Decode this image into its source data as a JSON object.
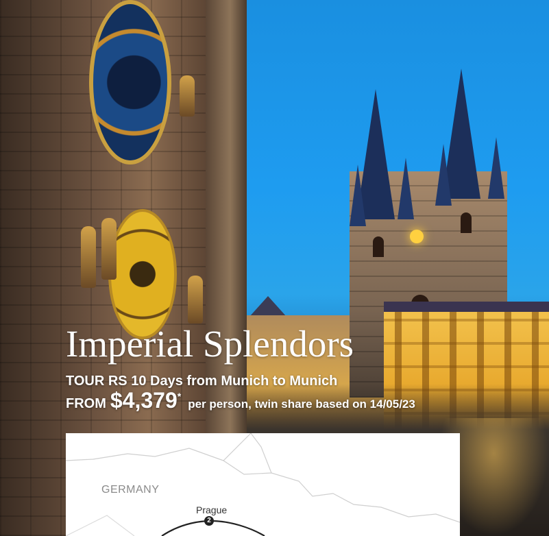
{
  "tour": {
    "title": "Imperial Splendors",
    "subtitle": "TOUR RS 10 Days from Munich to Munich",
    "from_label": "FROM",
    "price": "$4,379",
    "price_marker": "*",
    "price_note": "per person, twin share based on 14/05/23"
  },
  "map": {
    "country_label": "GERMANY",
    "city_label": "Prague",
    "stop_number": "2"
  },
  "colors": {
    "sky": "#1e9cf0",
    "text": "#ffffff",
    "map_background": "#ffffff",
    "map_label": "#8a8a8a"
  }
}
